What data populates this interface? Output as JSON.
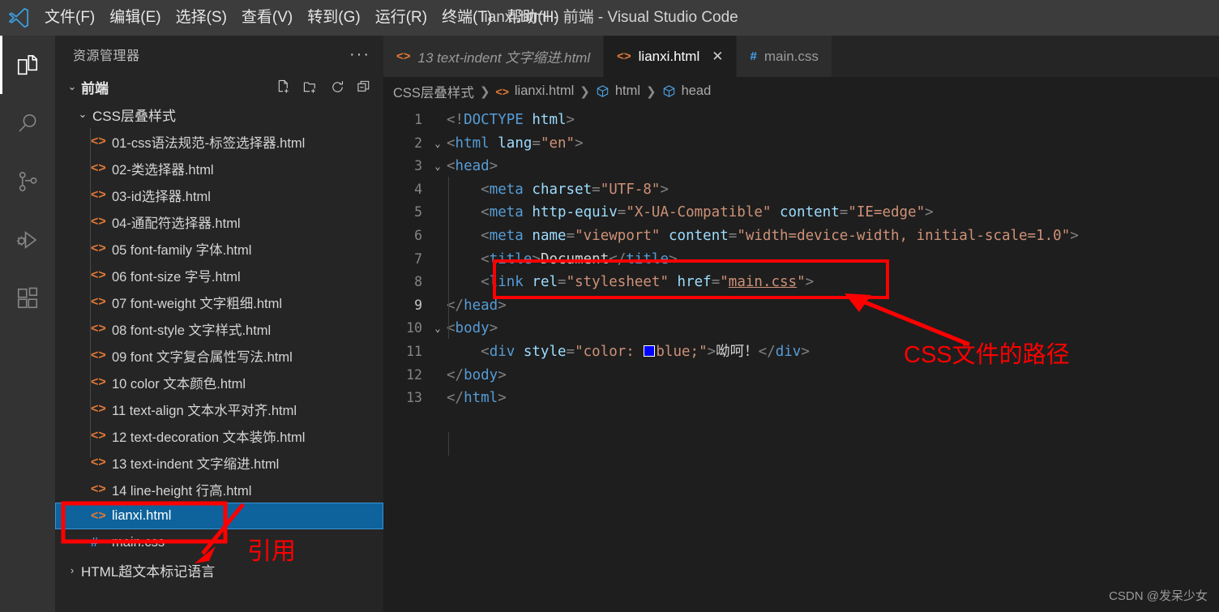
{
  "window": {
    "title": "lianxi.html - 前端 - Visual Studio Code",
    "logo_icon": "vscode-logo-icon"
  },
  "menubar": {
    "items": [
      {
        "label": "文件(F)"
      },
      {
        "label": "编辑(E)"
      },
      {
        "label": "选择(S)"
      },
      {
        "label": "查看(V)"
      },
      {
        "label": "转到(G)"
      },
      {
        "label": "运行(R)"
      },
      {
        "label": "终端(T)"
      },
      {
        "label": "帮助(H)"
      }
    ]
  },
  "activitybar": {
    "items": [
      {
        "name": "explorer-icon",
        "active": true
      },
      {
        "name": "search-icon",
        "active": false
      },
      {
        "name": "source-control-icon",
        "active": false
      },
      {
        "name": "run-and-debug-icon",
        "active": false
      },
      {
        "name": "extensions-icon",
        "active": false
      }
    ]
  },
  "sidebar": {
    "title": "资源管理器",
    "more_actions": "···",
    "root": {
      "name": "前端",
      "twisty": "⌄",
      "actions": [
        "new-file-icon",
        "new-folder-icon",
        "refresh-icon",
        "collapse-all-icon"
      ]
    },
    "folder": {
      "name": "CSS层叠样式",
      "twisty": "⌄"
    },
    "files": [
      {
        "name": "01-css语法规范-标签选择器.html",
        "icon": "html-icon"
      },
      {
        "name": "02-类选择器.html",
        "icon": "html-icon"
      },
      {
        "name": "03-id选择器.html",
        "icon": "html-icon"
      },
      {
        "name": "04-通配符选择器.html",
        "icon": "html-icon"
      },
      {
        "name": "05 font-family 字体.html",
        "icon": "html-icon"
      },
      {
        "name": "06 font-size 字号.html",
        "icon": "html-icon"
      },
      {
        "name": "07 font-weight 文字粗细.html",
        "icon": "html-icon"
      },
      {
        "name": "08 font-style 文字样式.html",
        "icon": "html-icon"
      },
      {
        "name": "09 font 文字复合属性写法.html",
        "icon": "html-icon"
      },
      {
        "name": "10 color 文本颜色.html",
        "icon": "html-icon"
      },
      {
        "name": "11 text-align 文本水平对齐.html",
        "icon": "html-icon"
      },
      {
        "name": "12 text-decoration 文本装饰.html",
        "icon": "html-icon"
      },
      {
        "name": "13 text-indent 文字缩进.html",
        "icon": "html-icon"
      },
      {
        "name": "14 line-height 行高.html",
        "icon": "html-icon"
      },
      {
        "name": "lianxi.html",
        "icon": "html-icon",
        "selected": true
      },
      {
        "name": "main.css",
        "icon": "css-icon"
      }
    ],
    "collapsed_folder": {
      "name": "HTML超文本标记语言",
      "twisty": "›"
    }
  },
  "tabs": [
    {
      "label": "13 text-indent 文字缩进.html",
      "icon": "html-icon",
      "active": false,
      "preview": true,
      "close": ""
    },
    {
      "label": "lianxi.html",
      "icon": "html-icon",
      "active": true,
      "preview": false,
      "close": "✕"
    },
    {
      "label": "main.css",
      "icon": "css-icon",
      "active": false,
      "preview": false,
      "close": ""
    }
  ],
  "breadcrumb": [
    {
      "label": "CSS层叠样式",
      "icon": "none"
    },
    {
      "label": "lianxi.html",
      "icon": "html-icon"
    },
    {
      "label": "html",
      "icon": "symbol-cube-icon"
    },
    {
      "label": "head",
      "icon": "symbol-cube-icon"
    }
  ],
  "code": {
    "lines": [
      {
        "n": "1",
        "fold": "",
        "text": "<!DOCTYPE html>"
      },
      {
        "n": "2",
        "fold": "⌄",
        "text": "<html lang=\"en\">"
      },
      {
        "n": "3",
        "fold": "⌄",
        "text": "<head>"
      },
      {
        "n": "4",
        "fold": "",
        "text": "    <meta charset=\"UTF-8\">"
      },
      {
        "n": "5",
        "fold": "",
        "text": "    <meta http-equiv=\"X-UA-Compatible\" content=\"IE=edge\">"
      },
      {
        "n": "6",
        "fold": "",
        "text": "    <meta name=\"viewport\" content=\"width=device-width, initial-scale=1.0\">"
      },
      {
        "n": "7",
        "fold": "",
        "text": "    <title>Document</title>"
      },
      {
        "n": "8",
        "fold": "",
        "text": "    <link rel=\"stylesheet\" href=\"main.css\">"
      },
      {
        "n": "9",
        "fold": "",
        "text": "</head>"
      },
      {
        "n": "10",
        "fold": "⌄",
        "text": "<body>"
      },
      {
        "n": "11",
        "fold": "",
        "text": "    <div style=\"color: blue;\">呦呵！</div>"
      },
      {
        "n": "12",
        "fold": "",
        "text": "</body>"
      },
      {
        "n": "13",
        "fold": "",
        "text": "</html>"
      }
    ],
    "color_swatch": "#0000ff"
  },
  "annotations": {
    "color": "#ff0000",
    "css_path_label": "CSS文件的路径",
    "reference_label": "引用"
  },
  "watermark": "CSDN @发呆少女"
}
